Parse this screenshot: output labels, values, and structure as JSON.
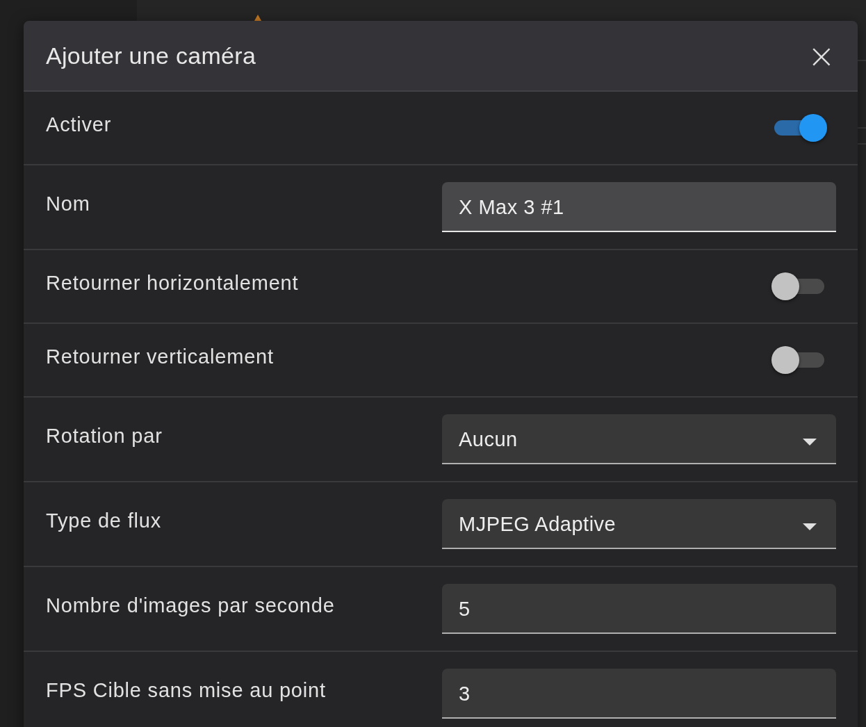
{
  "dialog": {
    "title": "Ajouter une caméra",
    "close": "×",
    "rows": [
      {
        "kind": "toggle",
        "label": "Activer",
        "on": true
      },
      {
        "kind": "text",
        "label": "Nom",
        "value": "X Max 3 #1",
        "focused": true
      },
      {
        "kind": "toggle",
        "label": "Retourner horizontalement",
        "on": false
      },
      {
        "kind": "toggle",
        "label": "Retourner verticalement",
        "on": false
      },
      {
        "kind": "select",
        "label": "Rotation par",
        "value": "Aucun",
        "focused": false
      },
      {
        "kind": "select",
        "label": "Type de flux",
        "value": "MJPEG Adaptive",
        "focused": false
      },
      {
        "kind": "text",
        "label": "Nombre d'images par seconde",
        "value": "5",
        "focused": false
      },
      {
        "kind": "text",
        "label": "FPS Cible sans mise au point",
        "value": "3",
        "focused": false
      }
    ]
  }
}
